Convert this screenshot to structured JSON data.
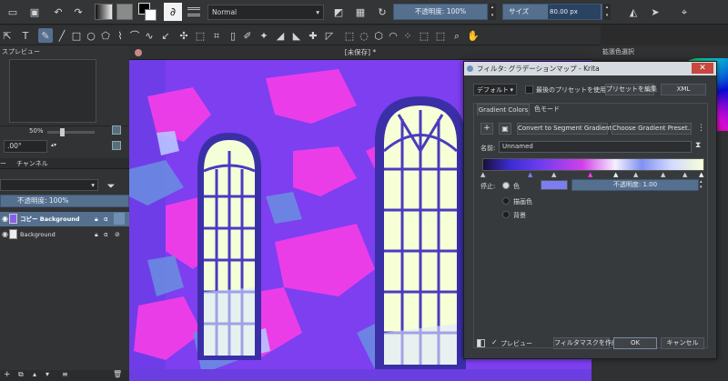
{
  "topbar": {
    "blend_mode": "Normal",
    "opacity_label": "不透明度: 100%",
    "size_label": "サイズ",
    "size_value": "80.00 px"
  },
  "left_panel": {
    "preview_title": "スプレビュー",
    "zoom_value": "50%",
    "rotation_value": ".00°",
    "channels_tab": "チャンネル",
    "layer_opacity": "不透明度: 100%",
    "layers": [
      {
        "name": "コピー Background",
        "selected": true
      },
      {
        "name": "Background",
        "selected": false
      }
    ]
  },
  "canvas": {
    "tab_title": "[未保存]",
    "tab_modified": "*"
  },
  "right_panel": {
    "title": "拡張色選択"
  },
  "dialog": {
    "title": "フィルタ: グラデーションマップ - Krita",
    "preset_value": "デフォルト",
    "last_preset_label": "最後のプリセットを使用",
    "edit_preset_button": "プリセットを編集",
    "xml_button": "XML",
    "tabs": [
      "Gradient Colors",
      "色モード"
    ],
    "convert_button": "Convert to Segment Gradient",
    "choose_button": "Choose Gradient Preset...",
    "name_label": "名前:",
    "name_value": "Unnamed",
    "stop_label": "停止:",
    "stop_options": [
      "色",
      "描画色",
      "背景"
    ],
    "stop_opacity": "不透明度: 1.00",
    "preview_label": "プレビュー",
    "create_mask_button": "フィルタマスクを作成",
    "ok_button": "OK",
    "cancel_button": "キャンセル",
    "colors": {
      "stop_color": "#7a7ef0",
      "accent_blue": "#55708f"
    }
  }
}
